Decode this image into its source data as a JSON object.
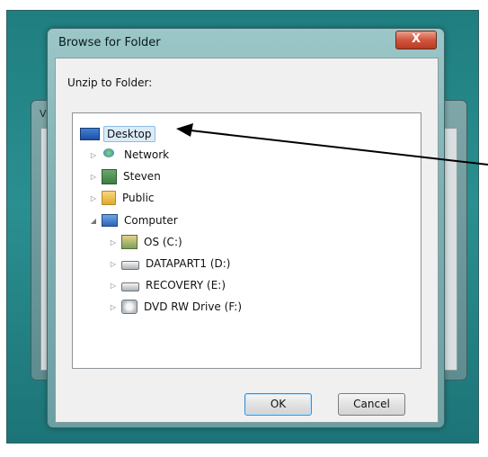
{
  "window": {
    "title": "Browse for Folder",
    "close_glyph": "X",
    "behind_letter": "V"
  },
  "dialog": {
    "prompt": "Unzip to Folder:"
  },
  "tree": {
    "items": [
      {
        "label": "Desktop",
        "icon": "desktop-icon",
        "expander": "",
        "selected": true
      },
      {
        "label": "Network",
        "icon": "network-icon",
        "expander": "▷"
      },
      {
        "label": "Steven",
        "icon": "user-folder-icon",
        "expander": "▷"
      },
      {
        "label": "Public",
        "icon": "folder-icon",
        "expander": "▷"
      },
      {
        "label": "Computer",
        "icon": "computer-icon",
        "expander": "◢"
      },
      {
        "label": "OS (C:)",
        "icon": "os-drive-icon",
        "expander": "▷"
      },
      {
        "label": "DATAPART1 (D:)",
        "icon": "hard-drive-icon",
        "expander": "▷"
      },
      {
        "label": "RECOVERY (E:)",
        "icon": "hard-drive-icon",
        "expander": "▷"
      },
      {
        "label": "DVD RW Drive (F:)",
        "icon": "dvd-drive-icon",
        "expander": "▷"
      }
    ]
  },
  "buttons": {
    "ok": "OK",
    "cancel": "Cancel"
  },
  "colors": {
    "backdrop": "#2a8f90",
    "selection": "#dcebf8",
    "close_button": "#d1553c"
  }
}
